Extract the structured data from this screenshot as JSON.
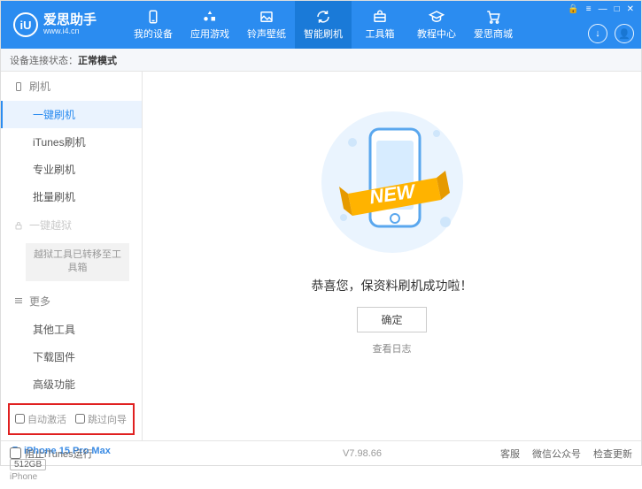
{
  "brand": {
    "name": "爱思助手",
    "url": "www.i4.cn",
    "logo_letter": "iU"
  },
  "nav": {
    "items": [
      {
        "label": "我的设备"
      },
      {
        "label": "应用游戏"
      },
      {
        "label": "铃声壁纸"
      },
      {
        "label": "智能刷机"
      },
      {
        "label": "工具箱"
      },
      {
        "label": "教程中心"
      },
      {
        "label": "爱思商城"
      }
    ]
  },
  "status": {
    "prefix": "设备连接状态：",
    "value": "正常模式"
  },
  "sidebar": {
    "group_flash": "刷机",
    "items_flash": [
      "一键刷机",
      "iTunes刷机",
      "专业刷机",
      "批量刷机"
    ],
    "group_jailbreak": "一键越狱",
    "jailbreak_note": "越狱工具已转移至工具箱",
    "group_more": "更多",
    "items_more": [
      "其他工具",
      "下载固件",
      "高级功能"
    ],
    "check_auto_activate": "自动激活",
    "check_skip_guide": "跳过向导"
  },
  "device": {
    "name": "iPhone 15 Pro Max",
    "storage": "512GB",
    "model": "iPhone"
  },
  "main": {
    "banner_text": "NEW",
    "message": "恭喜您，保资料刷机成功啦！",
    "ok": "确定",
    "log": "查看日志"
  },
  "footer": {
    "block_itunes": "阻止iTunes运行",
    "version": "V7.98.66",
    "links": [
      "客服",
      "微信公众号",
      "检查更新"
    ]
  }
}
